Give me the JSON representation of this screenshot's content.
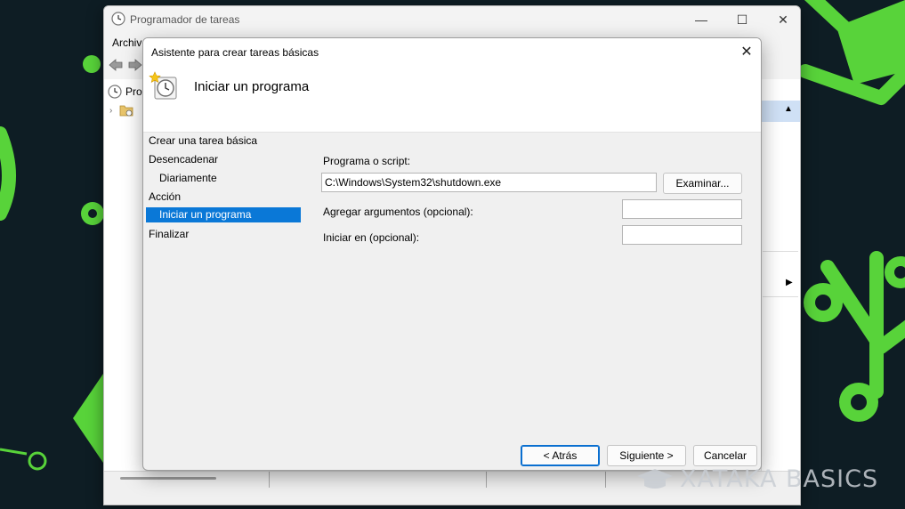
{
  "parent_window": {
    "title": "Programador de tareas",
    "menu_file": "Archivo",
    "tree_root_label": "Pro",
    "controls": {
      "minimize": "—",
      "maximize": "☐",
      "close": "✕"
    }
  },
  "wizard": {
    "title": "Asistente para crear tareas básicas",
    "close_glyph": "✕",
    "header_title": "Iniciar un programa",
    "steps": [
      "Crear una tarea básica",
      "Desencadenar",
      "Diariamente",
      "Acción",
      "Iniciar un programa",
      "Finalizar"
    ],
    "active_step": "Iniciar un programa",
    "program_label": "Programa o script:",
    "program_value": "C:\\Windows\\System32\\shutdown.exe",
    "browse_label": "Examinar...",
    "arguments_label": "Agregar argumentos (opcional):",
    "arguments_value": "",
    "start_in_label": "Iniciar en (opcional):",
    "start_in_value": "",
    "buttons": {
      "back": "< Atrás",
      "next": "Siguiente >",
      "cancel": "Cancelar"
    }
  },
  "watermark": {
    "text": "XATAKA BASICS"
  },
  "colors": {
    "accent": "#0a78d7",
    "wallpaper": "#0e1d24",
    "wallpaper_green": "#58d33a",
    "dialog_bg": "#f0f0f0"
  }
}
